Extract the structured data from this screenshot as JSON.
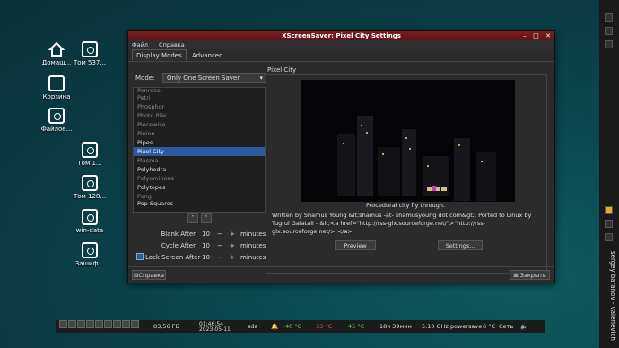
{
  "desktop_icons": [
    {
      "label": "Домаш..."
    },
    {
      "label": "Том 537..."
    },
    {
      "label": "Корзина"
    },
    {
      "label": "Файлое..."
    },
    {
      "label": "Том 1..."
    },
    {
      "label": "Том 128..."
    },
    {
      "label": "win-data"
    },
    {
      "label": "Зашиф..."
    }
  ],
  "window": {
    "title": "XScreenSaver: Pixel City Settings",
    "menu": [
      "Файл",
      "Справка"
    ],
    "tabs": [
      "Display Modes",
      "Advanced"
    ],
    "mode_label": "Mode:",
    "mode_value": "Only One Screen Saver",
    "list_items": [
      {
        "label": "Penrose",
        "dim": true
      },
      {
        "label": "Petri",
        "dim": true
      },
      {
        "label": "Phosphor",
        "dim": true
      },
      {
        "label": "Photo Pile",
        "dim": true
      },
      {
        "label": "Piecewise",
        "dim": true
      },
      {
        "label": "Pinion",
        "dim": true
      },
      {
        "label": "Pipes",
        "dim": false
      },
      {
        "label": "Pixel City",
        "dim": false,
        "selected": true
      },
      {
        "label": "Plasma",
        "dim": true
      },
      {
        "label": "Polyhedra",
        "dim": false
      },
      {
        "label": "Polyominoes",
        "dim": true
      },
      {
        "label": "Polytopes",
        "dim": false
      },
      {
        "label": "Pong",
        "dim": true
      },
      {
        "label": "Pop Squares",
        "dim": false
      }
    ],
    "blank_after": {
      "label": "Blank After",
      "value": "10",
      "unit": "minutes"
    },
    "cycle_after": {
      "label": "Cycle After",
      "value": "10",
      "unit": "minutes"
    },
    "lock_after": {
      "label": "Lock Screen After",
      "value": "10",
      "unit": "minutes",
      "checked": true
    },
    "preview_title": "Pixel City",
    "description": "Procedural city fly through.",
    "written": "Written by Shamus Young &lt;shamus -at- shamusyoung dot com&gt;. Ported to Linux by Tugrul Galatali - &lt;<a href=\"http://rss-glx.sourceforge.net/\">\"http://rss-glx.sourceforge.net/>.</a>",
    "preview_btn": "Preview",
    "settings_btn": "Settings...",
    "help_btn": "Справка",
    "close_btn": "Закрыть"
  },
  "taskbar": {
    "disk": "83,56 ГБ",
    "time": "01:46:54",
    "date": "2023-05-11",
    "drive": "sda",
    "temp1": "40 °C",
    "temp2": "33 °C",
    "temp3": "45 °C",
    "uptime": "18ч 39мин",
    "cpu": "5.10 GHz powersave",
    "weather": "6 °C",
    "network": "Сеть"
  },
  "side_panel": {
    "user": "sergey baranov - valerievich"
  }
}
